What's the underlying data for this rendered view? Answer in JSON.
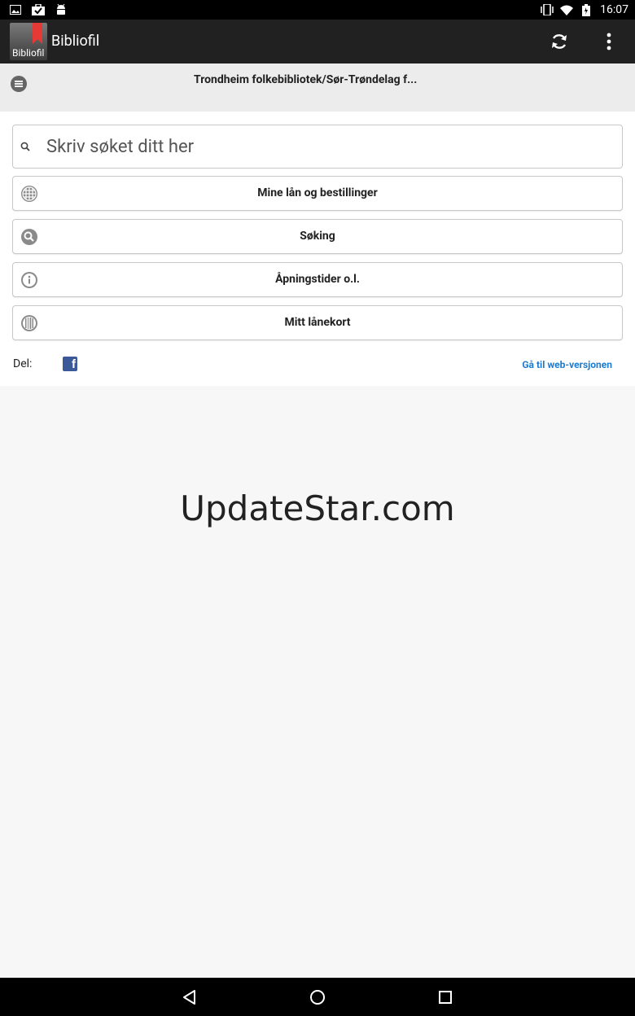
{
  "status_bar": {
    "time": "16:07",
    "left_icons": [
      "image-icon",
      "briefcase-check-icon",
      "android-icon"
    ],
    "right_icons": [
      "vibrate-icon",
      "wifi-icon",
      "battery-icon"
    ]
  },
  "app_bar": {
    "logo_text": "Bibliofil",
    "title": "Bibliofil",
    "actions": [
      "refresh-icon",
      "overflow-menu-icon"
    ]
  },
  "sub_header": {
    "library_name": "Trondheim folkebibliotek/Sør-Trøndelag f..."
  },
  "search": {
    "placeholder": "Skriv søket ditt her"
  },
  "menu": {
    "items": [
      {
        "label": "Mine lån og bestillinger",
        "icon": "globe-icon"
      },
      {
        "label": "Søking",
        "icon": "search-circle-icon"
      },
      {
        "label": "Åpningstider o.l.",
        "icon": "info-icon"
      },
      {
        "label": "Mitt lånekort",
        "icon": "barcode-icon"
      }
    ]
  },
  "share": {
    "label": "Del:",
    "facebook_icon": "facebook-icon",
    "web_link": "Gå til web-versjonen"
  },
  "watermark": "UpdateStar.com",
  "colors": {
    "app_bar": "#212121",
    "accent_link": "#1c7ccf",
    "facebook": "#3b5998",
    "bookmark_red": "#e53935"
  }
}
